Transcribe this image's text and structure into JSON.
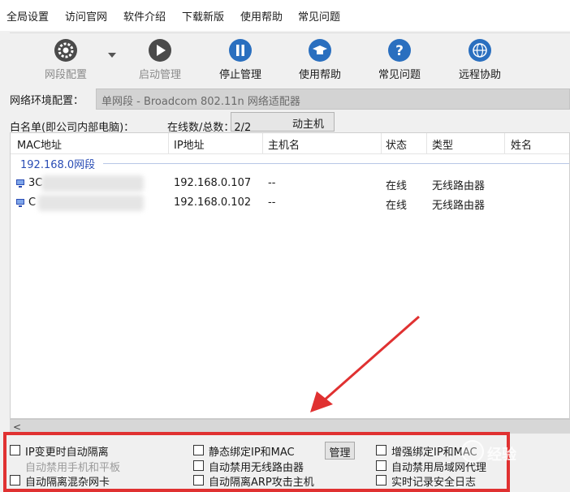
{
  "menu": {
    "items": [
      "全局设置",
      "访问官网",
      "软件介绍",
      "下载新版",
      "使用帮助",
      "常见问题"
    ]
  },
  "toolbar": {
    "buttons": [
      {
        "label": "网段配置",
        "icon": "gear-icon",
        "enabled": false
      },
      {
        "label": "启动管理",
        "icon": "play-icon",
        "enabled": false
      },
      {
        "label": "停止管理",
        "icon": "pause-icon",
        "enabled": true
      },
      {
        "label": "使用帮助",
        "icon": "graduation-cap-icon",
        "enabled": true
      },
      {
        "label": "常见问题",
        "icon": "question-icon",
        "enabled": true
      },
      {
        "label": "远程协助",
        "icon": "globe-icon",
        "enabled": true
      }
    ],
    "icon_color": "#2a6fbf"
  },
  "network": {
    "label": "网络环境配置：",
    "value": "单网段 - Broadcom 802.11n 网络适配器"
  },
  "whitelist": {
    "label": "白名单(即公司内部电脑)：",
    "online_count": "在线数/总数：2/2",
    "hosts_button": "动主机"
  },
  "hostlist": {
    "columns": [
      "MAC地址",
      "IP地址",
      "主机名",
      "状态",
      "类型",
      "姓名"
    ],
    "group": "192.168.0网段",
    "rows": [
      {
        "mac": "3C",
        "ip": "192.168.0.107",
        "hostname": "--",
        "status": "在线",
        "type": "无线路由器",
        "name": ""
      },
      {
        "mac": "C",
        "ip": "192.168.0.102",
        "hostname": "--",
        "status": "在线",
        "type": "无线路由器",
        "name": ""
      }
    ]
  },
  "scrollbar": {
    "left_arrow": "<"
  },
  "options": {
    "col1": [
      {
        "label": "IP变更时自动隔离",
        "enabled": true
      },
      {
        "label": "自动禁用手机和平板",
        "enabled": false
      },
      {
        "label": "自动隔离混杂网卡",
        "enabled": true
      }
    ],
    "col2": [
      {
        "label": "静态绑定IP和MAC",
        "enabled": true
      },
      {
        "label": "自动禁用无线路由器",
        "enabled": true
      },
      {
        "label": "自动隔离ARP攻击主机",
        "enabled": true
      }
    ],
    "col3": [
      {
        "label": "增强绑定IP和MAC",
        "enabled": true
      },
      {
        "label": "自动禁用局域网代理",
        "enabled": true
      },
      {
        "label": "实时记录安全日志",
        "enabled": true
      }
    ],
    "manage_button": "管理"
  },
  "overlay": {
    "watermark_text": "经验",
    "highlight_color": "#e03131"
  }
}
